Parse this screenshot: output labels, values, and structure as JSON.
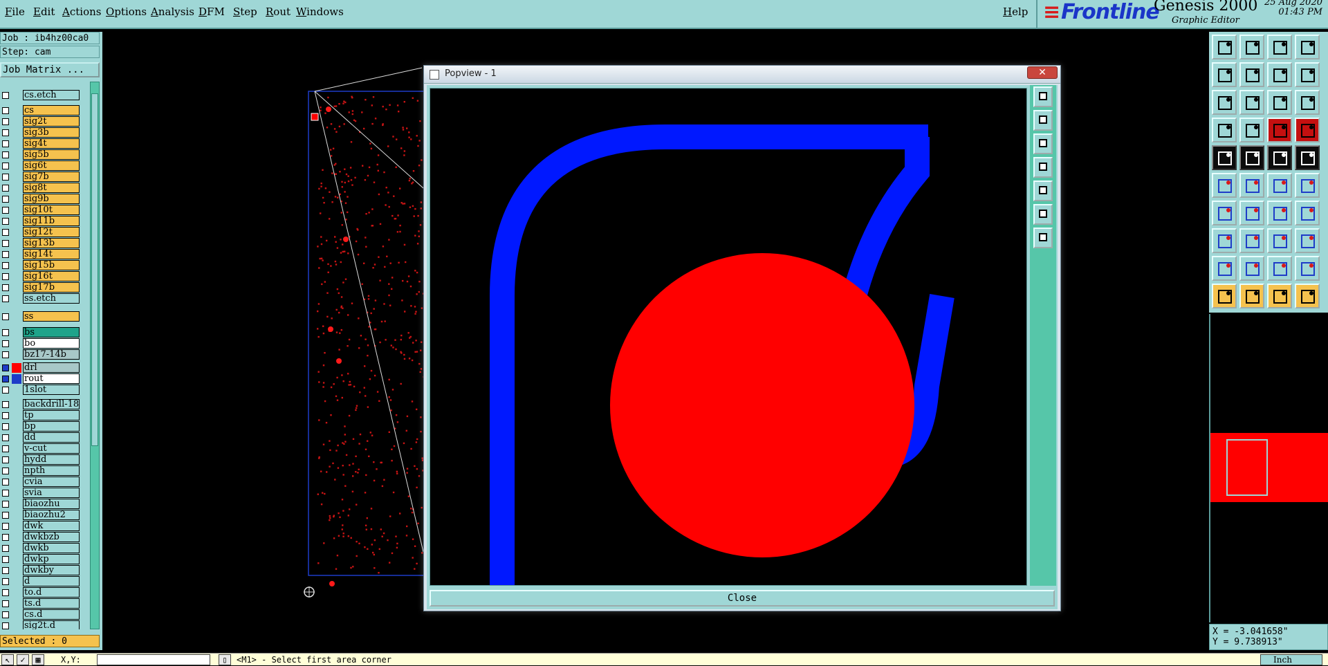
{
  "menubar": {
    "items": [
      "File",
      "Edit",
      "Actions",
      "Options",
      "Analysis",
      "DFM",
      "Step",
      "Rout",
      "Windows"
    ],
    "help": "Help"
  },
  "brand": {
    "logo": "Frontline",
    "product": "Genesis 2000",
    "subtitle": "Graphic Editor",
    "date": "25 Aug 2020",
    "time": "01:43 PM"
  },
  "left_panel": {
    "job": "Job : ib4hz00ca0",
    "step": "Step: cam",
    "job_matrix": "Job Matrix ...",
    "selected": "Selected : 0",
    "layers": [
      {
        "name": "cs.etch",
        "style": "misc",
        "active": false
      },
      {
        "name": "cs",
        "style": "board",
        "active": false
      },
      {
        "name": "sig2t",
        "style": "board",
        "active": false
      },
      {
        "name": "sig3b",
        "style": "board",
        "active": false
      },
      {
        "name": "sig4t",
        "style": "board",
        "active": false
      },
      {
        "name": "sig5b",
        "style": "board",
        "active": false
      },
      {
        "name": "sig6t",
        "style": "board",
        "active": false
      },
      {
        "name": "sig7b",
        "style": "board",
        "active": false
      },
      {
        "name": "sig8t",
        "style": "board",
        "active": false
      },
      {
        "name": "sig9b",
        "style": "board",
        "active": false
      },
      {
        "name": "sig10t",
        "style": "board",
        "active": false
      },
      {
        "name": "sig11b",
        "style": "board",
        "active": false
      },
      {
        "name": "sig12t",
        "style": "board",
        "active": false
      },
      {
        "name": "sig13b",
        "style": "board",
        "active": false
      },
      {
        "name": "sig14t",
        "style": "board",
        "active": false
      },
      {
        "name": "sig15b",
        "style": "board",
        "active": false
      },
      {
        "name": "sig16t",
        "style": "board",
        "active": false
      },
      {
        "name": "sig17b",
        "style": "board",
        "active": false
      },
      {
        "name": "ss.etch",
        "style": "misc",
        "active": false
      },
      {
        "name": "ss",
        "style": "board",
        "active": false
      },
      {
        "name": "bs",
        "style": "green",
        "active": false
      },
      {
        "name": "bo",
        "style": "white",
        "active": false
      },
      {
        "name": "bz17-14b",
        "style": "gray",
        "active": false
      },
      {
        "name": "drl",
        "style": "gray",
        "active": true,
        "color": "#ff0000"
      },
      {
        "name": "rout",
        "style": "white",
        "active": true,
        "color": "#1e3cc8"
      },
      {
        "name": "1slot",
        "style": "misc",
        "active": false
      },
      {
        "name": "backdrill-18",
        "style": "misc",
        "active": false
      },
      {
        "name": "tp",
        "style": "misc",
        "active": false
      },
      {
        "name": "bp",
        "style": "misc",
        "active": false
      },
      {
        "name": "dd",
        "style": "misc",
        "active": false
      },
      {
        "name": "v-cut",
        "style": "misc",
        "active": false
      },
      {
        "name": "hydd",
        "style": "misc",
        "active": false
      },
      {
        "name": "npth",
        "style": "misc",
        "active": false
      },
      {
        "name": "cvia",
        "style": "misc",
        "active": false
      },
      {
        "name": "svia",
        "style": "misc",
        "active": false
      },
      {
        "name": "biaozhu",
        "style": "misc",
        "active": false
      },
      {
        "name": "biaozhu2",
        "style": "misc",
        "active": false
      },
      {
        "name": "dwk",
        "style": "misc",
        "active": false
      },
      {
        "name": "dwkbzb",
        "style": "misc",
        "active": false
      },
      {
        "name": "dwkb",
        "style": "misc",
        "active": false
      },
      {
        "name": "dwkp",
        "style": "misc",
        "active": false
      },
      {
        "name": "dwkby",
        "style": "misc",
        "active": false
      },
      {
        "name": "d",
        "style": "misc",
        "active": false
      },
      {
        "name": "to.d",
        "style": "misc",
        "active": false
      },
      {
        "name": "ts.d",
        "style": "misc",
        "active": false
      },
      {
        "name": "cs.d",
        "style": "misc",
        "active": false
      },
      {
        "name": "sig2t.d",
        "style": "misc",
        "active": false
      }
    ]
  },
  "popview": {
    "title": "Popview - 1",
    "close_x": "✕",
    "close_button": "Close"
  },
  "coords": {
    "x": "X = -3.041658\"",
    "y": "Y = 9.738913\""
  },
  "statusbar": {
    "xy_label": "X,Y:",
    "prompt": "<M1> - Select first area corner",
    "units": "Inch"
  },
  "colors": {
    "panel": "#9fd7d6",
    "board_layer": "#f5c24e",
    "drill": "#ff0000",
    "rout": "#1e3cc8",
    "accent": "#56c6a9"
  },
  "toolbox_icons": [
    "open-job-icon",
    "save-icon",
    "home-icon",
    "layout-icon",
    "import-icon",
    "export-icon",
    "panel-icon",
    "step-icon",
    "zoom-fit-icon",
    "zoom-center-icon",
    "zoom-1to1-icon",
    "help-icon",
    "measure-icon",
    "grid-icon",
    "snap-icon",
    "snap-active-icon",
    "cursor-add-icon",
    "add-line-icon",
    "add-pad-icon",
    "add-round-icon",
    "connect-icon",
    "delete-icon",
    "move-icon",
    "copy-icon",
    "angle-icon",
    "line-edit-icon",
    "arc-icon",
    "mirror-icon",
    "node-icon",
    "trim-icon",
    "fill-icon",
    "group-icon",
    "poly-icon",
    "poly-edit-icon",
    "poly-cut-icon",
    "poly-merge-icon",
    "select-icon",
    "select-feature-icon",
    "select-net-icon",
    "select-multi-icon"
  ]
}
